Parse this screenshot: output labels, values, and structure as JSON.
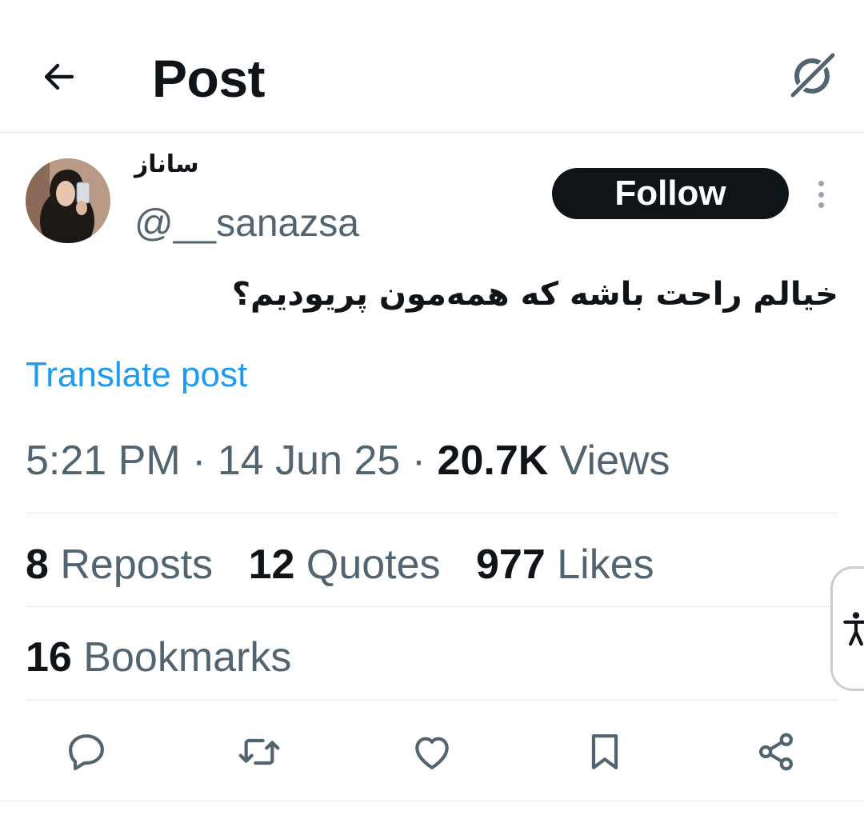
{
  "header": {
    "title": "Post",
    "back_icon": "arrow-left-icon",
    "grok_icon": "grok-icon"
  },
  "author": {
    "display_name": "ساناز",
    "handle": "@__sanazsa",
    "follow_label": "Follow"
  },
  "post": {
    "text": "خیالم راحت باشه که همه‌مون پریودیم؟",
    "translate_label": "Translate post"
  },
  "meta": {
    "time": "5:21 PM",
    "separator": "·",
    "date": "14 Jun 25",
    "views_count": "20.7K",
    "views_label": "Views"
  },
  "stats": {
    "reposts_count": "8",
    "reposts_label": "Reposts",
    "quotes_count": "12",
    "quotes_label": "Quotes",
    "likes_count": "977",
    "likes_label": "Likes",
    "bookmarks_count": "16",
    "bookmarks_label": "Bookmarks"
  },
  "actions": [
    "reply-icon",
    "repost-icon",
    "like-icon",
    "bookmark-icon",
    "share-icon"
  ],
  "colors": {
    "text": "#0f1419",
    "secondary": "#536471",
    "link": "#1d9bf0",
    "divider": "#e1e6ea"
  }
}
